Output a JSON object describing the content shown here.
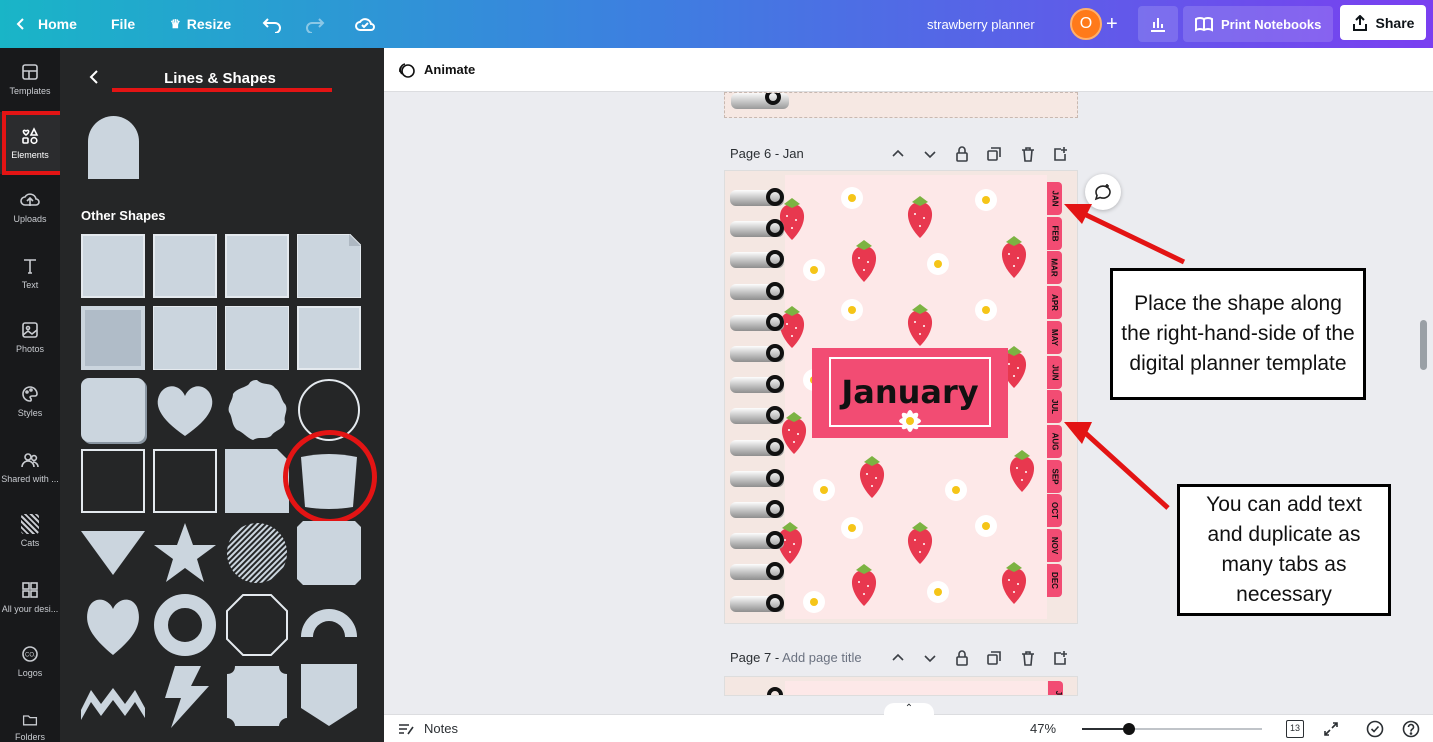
{
  "topbar": {
    "home": "Home",
    "file": "File",
    "resize": "Resize",
    "doc_title": "strawberry planner",
    "avatar_letter": "O",
    "print": "Print Notebooks",
    "share": "Share"
  },
  "rail": {
    "items": [
      {
        "label": "Templates",
        "icon": "templates-icon"
      },
      {
        "label": "Elements",
        "icon": "elements-icon"
      },
      {
        "label": "Uploads",
        "icon": "uploads-icon"
      },
      {
        "label": "Text",
        "icon": "text-icon"
      },
      {
        "label": "Photos",
        "icon": "photos-icon"
      },
      {
        "label": "Styles",
        "icon": "styles-icon"
      },
      {
        "label": "Shared with ...",
        "icon": "shared-icon"
      },
      {
        "label": "Cats",
        "icon": "cats-icon"
      },
      {
        "label": "All your desi...",
        "icon": "all-designs-icon"
      },
      {
        "label": "Logos",
        "icon": "logos-icon"
      },
      {
        "label": "Folders",
        "icon": "folders-icon"
      }
    ]
  },
  "panel": {
    "title": "Lines & Shapes",
    "section": "Other Shapes"
  },
  "editor": {
    "animate": "Animate",
    "page6_title": "Page 6 - Jan",
    "page7_prefix": "Page 7 -",
    "page7_placeholder": "Add page title",
    "heading": "January",
    "tabs": [
      "JAN",
      "FEB",
      "MAR",
      "APR",
      "MAY",
      "JUN",
      "JUL",
      "AUG",
      "SEP",
      "OCT",
      "NOV",
      "DEC"
    ],
    "page7_tab": "J"
  },
  "callouts": {
    "first": "Place the shape along the right-hand-side of the digital planner template",
    "second": "You can add text and duplicate as many tabs as necessary"
  },
  "bottombar": {
    "notes": "Notes",
    "zoom": "47%",
    "zoom_fraction": 0.47,
    "page_count": "13"
  },
  "colors": {
    "accent_pink": "#f24c73",
    "annotation_red": "#e31414",
    "topbar_start": "#19b5c7",
    "topbar_end": "#7a3ff0"
  }
}
